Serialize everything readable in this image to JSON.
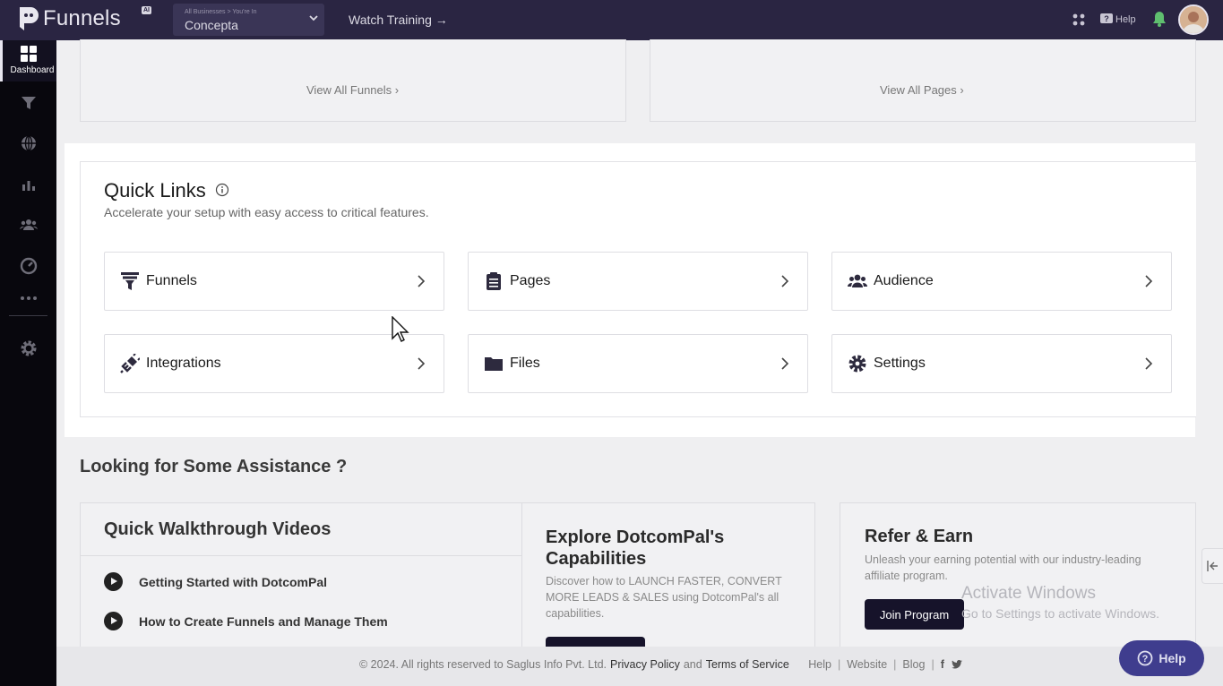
{
  "topbar": {
    "logo_text": "Funnels",
    "logo_badge": "AI",
    "business_sublabel": "All Businesses > You're In",
    "business_name": "Concepta",
    "watch_training": "Watch Training →",
    "help_label": "Help"
  },
  "sidebar": {
    "dashboard_label": "Dashboard"
  },
  "top_cards": {
    "view_all_funnels": "View All Funnels",
    "view_all_pages": "View All Pages"
  },
  "quick_links": {
    "title": "Quick Links",
    "subtitle": "Accelerate your setup with easy access to critical features.",
    "items": [
      {
        "label": "Funnels",
        "icon": "funnel-icon"
      },
      {
        "label": "Pages",
        "icon": "clipboard-icon"
      },
      {
        "label": "Audience",
        "icon": "users-icon"
      },
      {
        "label": "Integrations",
        "icon": "plug-icon"
      },
      {
        "label": "Files",
        "icon": "folder-icon"
      },
      {
        "label": "Settings",
        "icon": "gear-icon"
      }
    ]
  },
  "assistance": {
    "title": "Looking for Some Assistance ?",
    "walkthrough_title": "Quick Walkthrough Videos",
    "videos": [
      "Getting Started with DotcomPal",
      "How to Create Funnels and Manage Them"
    ],
    "explore_title": "Explore DotcomPal's Capabilities",
    "explore_desc": "Discover how to LAUNCH FASTER, CONVERT MORE LEADS & SALES using DotcomPal's all capabilities.",
    "refer_title": "Refer & Earn",
    "refer_desc": "Unleash your earning potential with our industry-leading affiliate program.",
    "join_label": "Join Program"
  },
  "watermark": {
    "line1": "Activate Windows",
    "line2": "Go to Settings to activate Windows."
  },
  "footer": {
    "copyright": "©  2024. All rights reserved to Saglus Info Pvt. Ltd.",
    "privacy": "Privacy Policy",
    "and": "and",
    "terms": "Terms of Service",
    "help": "Help",
    "website": "Website",
    "blog": "Blog",
    "fab_help": "Help"
  },
  "colors": {
    "topbar": "#2a2542",
    "sidebar": "#08070d",
    "accent": "#16132a",
    "fab": "#3f3d8e"
  }
}
